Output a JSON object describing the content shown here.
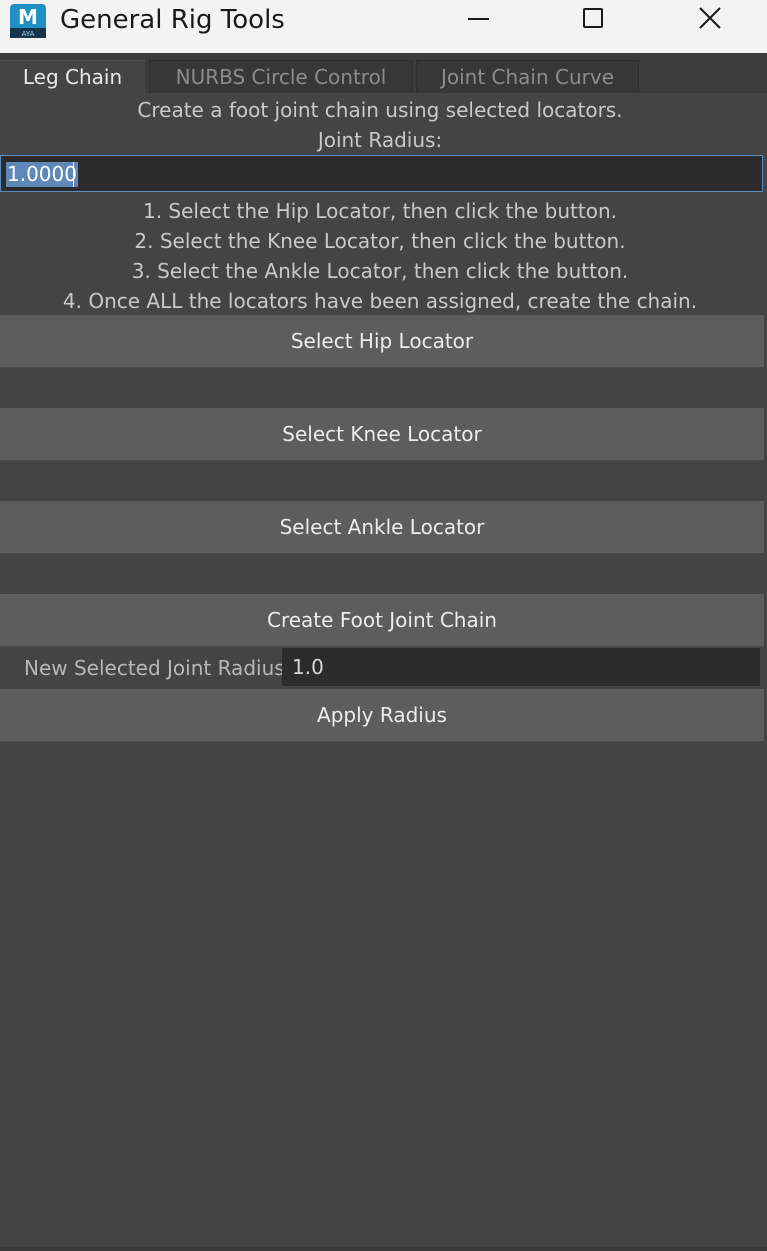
{
  "window": {
    "title": "General Rig Tools",
    "icon": "maya-app-icon",
    "icon_letter": "M",
    "icon_sub": "AYA",
    "controls": [
      "minimize-icon",
      "maximize-icon",
      "close-icon"
    ]
  },
  "tabs": [
    {
      "label": "Leg Chain",
      "active": true
    },
    {
      "label": "NURBS Circle Control",
      "active": false
    },
    {
      "label": "Joint Chain Curve",
      "active": false
    }
  ],
  "leg_chain": {
    "description": "Create a foot joint chain using selected locators.",
    "joint_radius_label": "Joint Radius:",
    "joint_radius_value": "1.0000",
    "instructions": [
      "1. Select the Hip Locator, then click the button.",
      "2. Select the Knee Locator, then click the button.",
      "3. Select the Ankle Locator, then click the button.",
      "4. Once ALL the locators have been assigned, create the chain."
    ],
    "buttons": {
      "hip": "Select Hip Locator",
      "knee": "Select Knee Locator",
      "ankle": "Select Ankle Locator",
      "create": "Create Foot Joint Chain",
      "apply": "Apply Radius"
    },
    "new_radius_label": "New Selected Joint Radius",
    "new_radius_value": "1.0"
  },
  "colors": {
    "background": "#444444",
    "titlebar": "#f3f3f3",
    "button": "#5d5d5d",
    "field": "#2b2b2b",
    "selection": "#5f87b8",
    "maya_blue": "#1f8fc4"
  }
}
